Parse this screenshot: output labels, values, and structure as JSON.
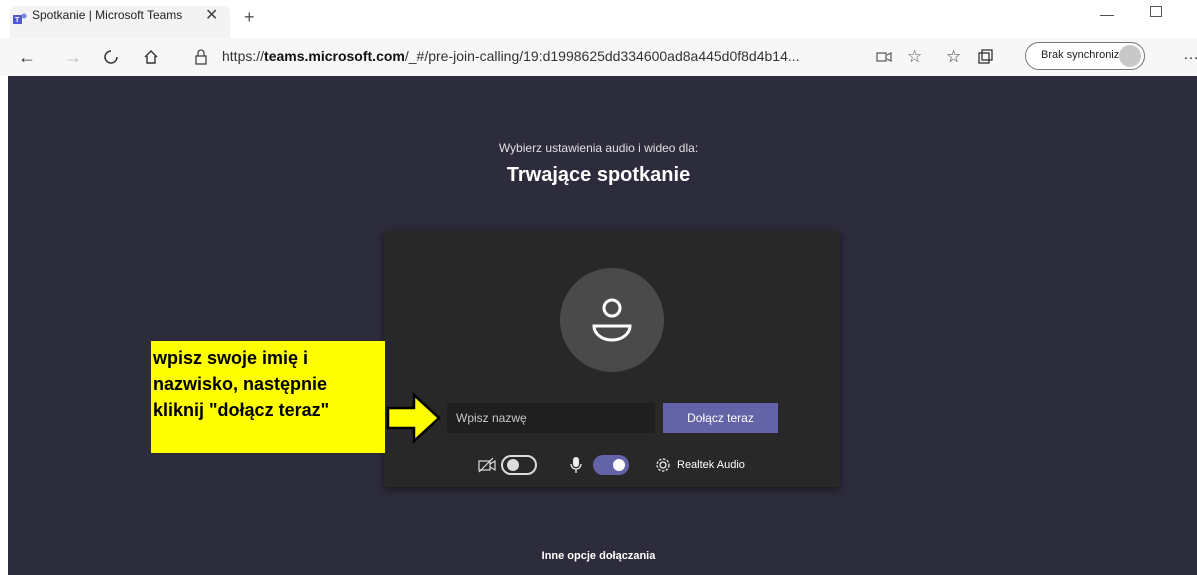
{
  "browser": {
    "tab_title": "Spotkanie | Microsoft Teams",
    "tab_icon": "teams-logo-icon",
    "url_prefix": "https://",
    "url_domain": "teams.microsoft.com",
    "url_path": "/_#/pre-join-calling/19:d1998625dd334600ad8a445d0f8d4b14...",
    "sync_label": "Brak synchronizacji"
  },
  "prejoin": {
    "prompt": "Wybierz ustawienia audio i wideo dla:",
    "meeting_title": "Trwające spotkanie",
    "name_placeholder": "Wpisz nazwę",
    "join_label": "Dołącz teraz",
    "camera_on": false,
    "mic_on": true,
    "audio_device": "Realtek Audio",
    "other_options": "Inne opcje dołączania"
  },
  "annotation": {
    "lines": [
      "wpisz swoje imię i",
      "nazwisko, następnie",
      "kliknij \"dołącz teraz\""
    ]
  },
  "colors": {
    "page_bg": "#2d2c3c",
    "card_bg": "#292828",
    "accent": "#6264a7",
    "callout": "#ffff00"
  }
}
